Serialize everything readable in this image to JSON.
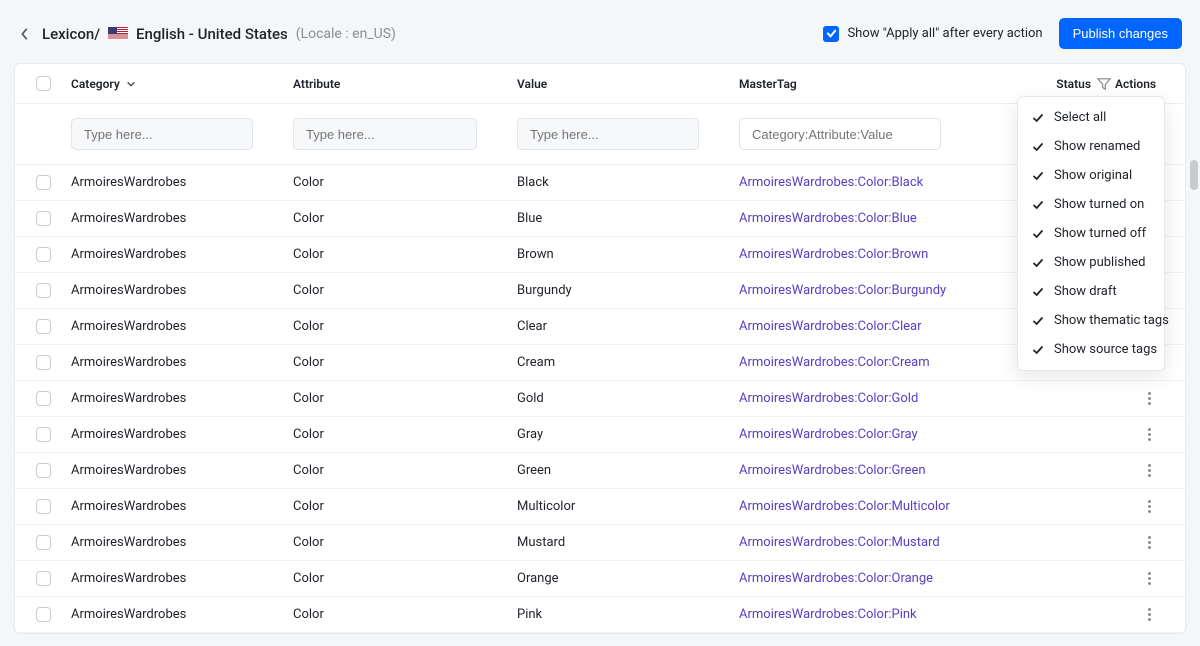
{
  "breadcrumb": {
    "root": "Lexicon/",
    "locale_label": "English - United States",
    "locale_code": "(Locale : en_US)"
  },
  "topbar": {
    "apply_all_label": "Show \"Apply all\" after every action",
    "publish_label": "Publish changes"
  },
  "columns": {
    "category": "Category",
    "attribute": "Attribute",
    "value": "Value",
    "mastertag": "MasterTag",
    "status": "Status",
    "actions": "Actions"
  },
  "filters": {
    "type_here": "Type here...",
    "master_placeholder": "Category:Attribute:Value"
  },
  "status_menu": {
    "items": [
      {
        "label": "Select all"
      },
      {
        "label": "Show renamed"
      },
      {
        "label": "Show original"
      },
      {
        "label": "Show turned on"
      },
      {
        "label": "Show turned off"
      },
      {
        "label": "Show published"
      },
      {
        "label": "Show draft"
      },
      {
        "label": "Show thematic tags"
      },
      {
        "label": "Show source tags"
      }
    ]
  },
  "rows": [
    {
      "category": "ArmoiresWardrobes",
      "attribute": "Color",
      "value": "Black",
      "mastertag": "ArmoiresWardrobes:Color:Black"
    },
    {
      "category": "ArmoiresWardrobes",
      "attribute": "Color",
      "value": "Blue",
      "mastertag": "ArmoiresWardrobes:Color:Blue"
    },
    {
      "category": "ArmoiresWardrobes",
      "attribute": "Color",
      "value": "Brown",
      "mastertag": "ArmoiresWardrobes:Color:Brown"
    },
    {
      "category": "ArmoiresWardrobes",
      "attribute": "Color",
      "value": "Burgundy",
      "mastertag": "ArmoiresWardrobes:Color:Burgundy"
    },
    {
      "category": "ArmoiresWardrobes",
      "attribute": "Color",
      "value": "Clear",
      "mastertag": "ArmoiresWardrobes:Color:Clear"
    },
    {
      "category": "ArmoiresWardrobes",
      "attribute": "Color",
      "value": "Cream",
      "mastertag": "ArmoiresWardrobes:Color:Cream"
    },
    {
      "category": "ArmoiresWardrobes",
      "attribute": "Color",
      "value": "Gold",
      "mastertag": "ArmoiresWardrobes:Color:Gold"
    },
    {
      "category": "ArmoiresWardrobes",
      "attribute": "Color",
      "value": "Gray",
      "mastertag": "ArmoiresWardrobes:Color:Gray"
    },
    {
      "category": "ArmoiresWardrobes",
      "attribute": "Color",
      "value": "Green",
      "mastertag": "ArmoiresWardrobes:Color:Green"
    },
    {
      "category": "ArmoiresWardrobes",
      "attribute": "Color",
      "value": "Multicolor",
      "mastertag": "ArmoiresWardrobes:Color:Multicolor"
    },
    {
      "category": "ArmoiresWardrobes",
      "attribute": "Color",
      "value": "Mustard",
      "mastertag": "ArmoiresWardrobes:Color:Mustard"
    },
    {
      "category": "ArmoiresWardrobes",
      "attribute": "Color",
      "value": "Orange",
      "mastertag": "ArmoiresWardrobes:Color:Orange"
    },
    {
      "category": "ArmoiresWardrobes",
      "attribute": "Color",
      "value": "Pink",
      "mastertag": "ArmoiresWardrobes:Color:Pink"
    }
  ]
}
